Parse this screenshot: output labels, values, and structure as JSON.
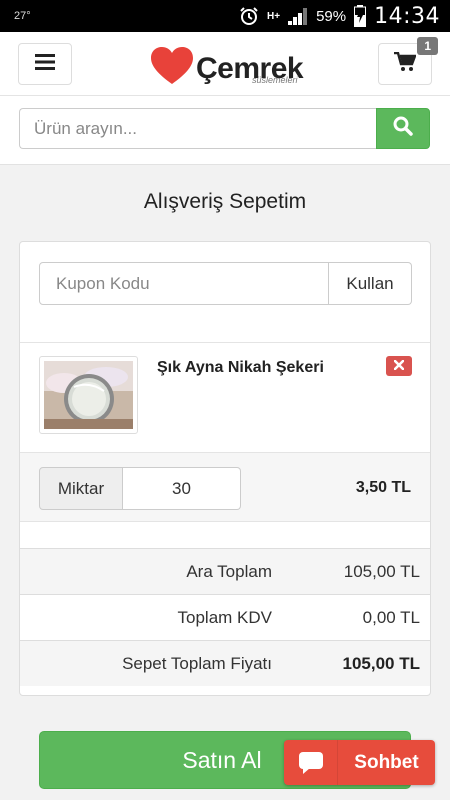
{
  "status_bar": {
    "temperature": "27°",
    "network_type": "H+",
    "battery_percent": "59%",
    "time": "14:34"
  },
  "header": {
    "brand_name": "Çemrek",
    "brand_sub": "süslemeleri",
    "cart_count": "1",
    "icons": [
      "menu-icon",
      "heart-logo-icon",
      "cart-icon"
    ]
  },
  "search": {
    "placeholder": "Ürün arayın...",
    "value": ""
  },
  "page": {
    "title": "Alışveriş Sepetim"
  },
  "coupon": {
    "placeholder": "Kupon Kodu",
    "button_label": "Kullan"
  },
  "cart_items": [
    {
      "name": "Şık Ayna Nikah Şekeri",
      "quantity_label": "Miktar",
      "quantity": "30",
      "unit_price": "3,50 TL"
    }
  ],
  "totals": [
    {
      "label": "Ara Toplam",
      "value": "105,00 TL"
    },
    {
      "label": "Toplam KDV",
      "value": "0,00 TL"
    },
    {
      "label": "Sepet Toplam Fiyatı",
      "value": "105,00 TL"
    }
  ],
  "actions": {
    "buy_label": "Satın Al",
    "chat_label": "Sohbet"
  },
  "colors": {
    "primary_green": "#5cb85c",
    "danger_red": "#d9534f",
    "chat_red": "#e74c3c",
    "logo_red": "#e8423a"
  }
}
